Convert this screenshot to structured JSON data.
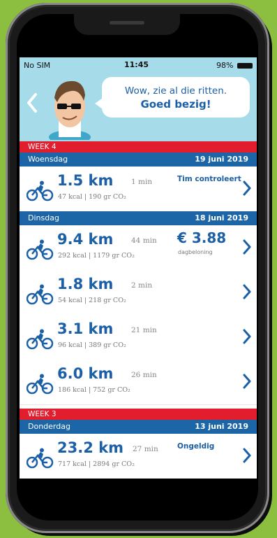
{
  "status_bar": {
    "carrier": "No SIM",
    "time": "11:45",
    "battery": "98%"
  },
  "header": {
    "message_line1": "Wow, zie al die ritten.",
    "message_line2": "Goed bezig!"
  },
  "weeks": [
    {
      "label": "WEEK 4"
    },
    {
      "label": "WEEK 3"
    }
  ],
  "days": [
    {
      "name": "Woensdag",
      "date": "19 juni 2019"
    },
    {
      "name": "Dinsdag",
      "date": "18 juni 2019"
    },
    {
      "name": "Donderdag",
      "date": "13 juni 2019"
    }
  ],
  "rides": [
    {
      "distance": "1.5 km",
      "duration": "1 min",
      "stats": "47 kcal | 190 gr CO₂",
      "status": "Tim controleert"
    },
    {
      "distance": "9.4 km",
      "duration": "44 min",
      "stats": "292 kcal | 1179 gr CO₂",
      "amount": "€ 3.88",
      "amount_label": "dagbeloning"
    },
    {
      "distance": "1.8 km",
      "duration": "2 min",
      "stats": "54 kcal | 218 gr CO₂"
    },
    {
      "distance": "3.1 km",
      "duration": "21 min",
      "stats": "96 kcal | 389 gr CO₂"
    },
    {
      "distance": "6.0 km",
      "duration": "26 min",
      "stats": "186 kcal | 752 gr CO₂"
    },
    {
      "distance": "23.2 km",
      "duration": "27 min",
      "stats": "717 kcal | 2894 gr CO₂",
      "status": "Ongeldig"
    }
  ],
  "icons": {
    "back": "chevron-left-icon",
    "bike": "bicycle-icon",
    "row_chevron": "chevron-right-icon"
  },
  "colors": {
    "primary": "#1b5fa6",
    "week": "#e11d2e",
    "day": "#1c66a8",
    "header": "#a6dbea",
    "background": "#8cbf3f"
  }
}
